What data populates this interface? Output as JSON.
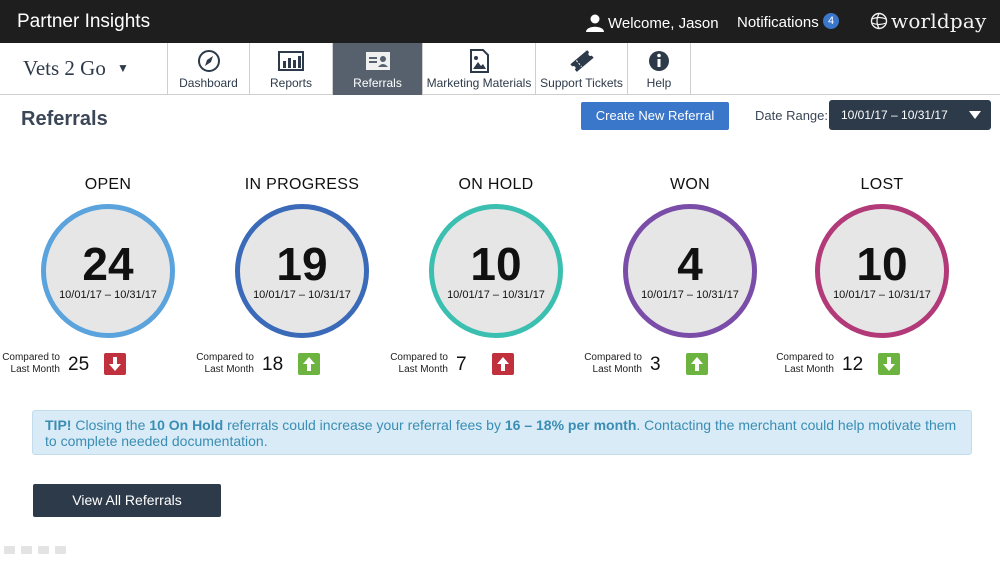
{
  "topbar": {
    "title": "Partner Insights",
    "welcome": "Welcome, Jason",
    "notifications_label": "Notifications",
    "notifications_count": "4",
    "logo": "worldpay"
  },
  "nav": {
    "brand": "Vets 2 Go",
    "tabs": [
      {
        "label": "Dashboard",
        "icon": "compass-icon"
      },
      {
        "label": "Reports",
        "icon": "bar-chart-icon"
      },
      {
        "label": "Referrals",
        "icon": "id-card-icon",
        "active": true
      },
      {
        "label": "Marketing Materials",
        "icon": "image-file-icon"
      },
      {
        "label": "Support Tickets",
        "icon": "ticket-icon"
      },
      {
        "label": "Help",
        "icon": "info-icon"
      }
    ]
  },
  "header": {
    "title": "Referrals",
    "create_button": "Create New Referral",
    "date_range_label": "Date Range:",
    "date_range_value": "10/01/17 – 10/31/17"
  },
  "statuses": [
    {
      "title": "OPEN",
      "count": "24",
      "dates": "10/01/17 – 10/31/17",
      "compare_label": "Compared to Last Month",
      "compare_value": "25",
      "trend": "down",
      "color": "#5ba3dd"
    },
    {
      "title": "IN PROGRESS",
      "count": "19",
      "dates": "10/01/17 – 10/31/17",
      "compare_label": "Compared to Last Month",
      "compare_value": "18",
      "trend": "up",
      "color": "#3a6ab8"
    },
    {
      "title": "ON HOLD",
      "count": "10",
      "dates": "10/01/17 – 10/31/17",
      "compare_label": "Compared to Last Month",
      "compare_value": "7",
      "trend": "up-red",
      "color": "#3bbfb1"
    },
    {
      "title": "WON",
      "count": "4",
      "dates": "10/01/17 – 10/31/17",
      "compare_label": "Compared to Last Month",
      "compare_value": "3",
      "trend": "up",
      "color": "#7a4ea8"
    },
    {
      "title": "LOST",
      "count": "10",
      "dates": "10/01/17 – 10/31/17",
      "compare_label": "Compared to Last Month",
      "compare_value": "12",
      "trend": "down-green",
      "color": "#b23a78"
    }
  ],
  "tip": {
    "prefix": "TIP!",
    "t1": " Closing the ",
    "b1": "10 On Hold",
    "t2": " referrals could increase your referral fees by ",
    "b2": "16 – 18% per month",
    "t3": ". Contacting the merchant could help motivate them to complete needed documentation."
  },
  "view_all_button": "View All Referrals",
  "colors": {
    "accent": "#3a76c9",
    "dark": "#2d3a4a",
    "down": "#c0313d",
    "up": "#6cb33f"
  }
}
